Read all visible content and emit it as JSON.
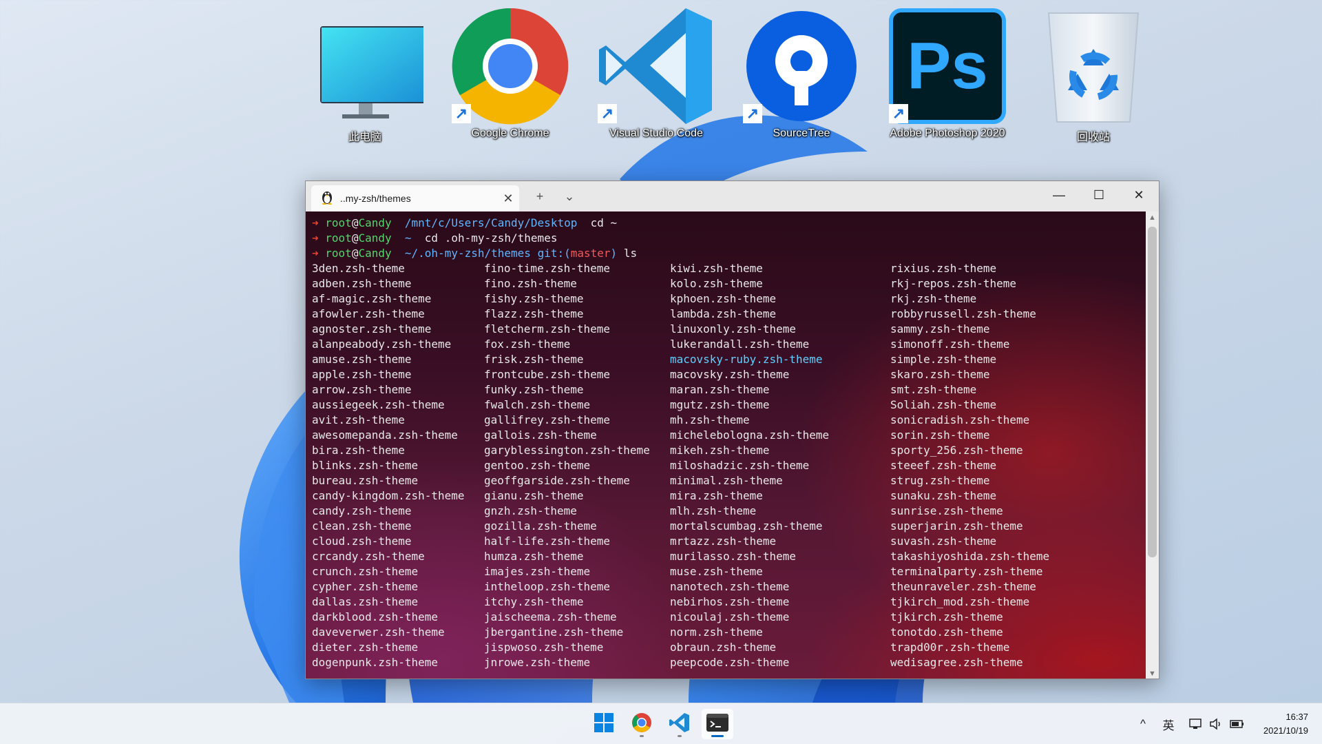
{
  "desktop_icons": [
    {
      "name": "this-pc",
      "label": "此电脑",
      "icon": "monitor-icon",
      "shortcut": false
    },
    {
      "name": "google-chrome",
      "label": "Google Chrome",
      "icon": "chrome-icon",
      "shortcut": true
    },
    {
      "name": "visual-studio-code",
      "label": "Visual Studio Code",
      "icon": "vscode-icon",
      "shortcut": true
    },
    {
      "name": "sourcetree",
      "label": "SourceTree",
      "icon": "sourcetree-icon",
      "shortcut": true
    },
    {
      "name": "adobe-photoshop",
      "label": "Adobe Photoshop 2020",
      "icon": "photoshop-icon",
      "shortcut": true,
      "icon_text": "Ps"
    },
    {
      "name": "recycle-bin",
      "label": "回收站",
      "icon": "recycle-bin-icon",
      "shortcut": false
    }
  ],
  "terminal": {
    "tab_title": "..my-zsh/themes",
    "tab_icon": "linux-penguin-icon",
    "new_tab_glyph": "+",
    "dropdown_glyph": "⌄",
    "minimize_glyph": "—",
    "maximize_glyph": "☐",
    "close_glyph": "✕",
    "prompts": [
      {
        "arrow": "➜",
        "user": "root",
        "at": "@",
        "host": "Candy",
        "path": "/mnt/c/Users/Candy/Desktop",
        "git_label": "",
        "branch": "",
        "cmd": "cd ~"
      },
      {
        "arrow": "➜",
        "user": "root",
        "at": "@",
        "host": "Candy",
        "path": "~",
        "git_label": "",
        "branch": "",
        "cmd": "cd .oh-my-zsh/themes"
      },
      {
        "arrow": "➜",
        "user": "root",
        "at": "@",
        "host": "Candy",
        "path": "~/.oh-my-zsh/themes",
        "git_label": "git:(",
        "branch": "master",
        "git_close": ")",
        "cmd": "ls"
      }
    ],
    "highlighted_file": "macovsky-ruby.zsh-theme",
    "ls_columns": [
      [
        "3den.zsh-theme",
        "adben.zsh-theme",
        "af-magic.zsh-theme",
        "afowler.zsh-theme",
        "agnoster.zsh-theme",
        "alanpeabody.zsh-theme",
        "amuse.zsh-theme",
        "apple.zsh-theme",
        "arrow.zsh-theme",
        "aussiegeek.zsh-theme",
        "avit.zsh-theme",
        "awesomepanda.zsh-theme",
        "bira.zsh-theme",
        "blinks.zsh-theme",
        "bureau.zsh-theme",
        "candy-kingdom.zsh-theme",
        "candy.zsh-theme",
        "clean.zsh-theme",
        "cloud.zsh-theme",
        "crcandy.zsh-theme",
        "crunch.zsh-theme",
        "cypher.zsh-theme",
        "dallas.zsh-theme",
        "darkblood.zsh-theme",
        "daveverwer.zsh-theme",
        "dieter.zsh-theme",
        "dogenpunk.zsh-theme"
      ],
      [
        "fino-time.zsh-theme",
        "fino.zsh-theme",
        "fishy.zsh-theme",
        "flazz.zsh-theme",
        "fletcherm.zsh-theme",
        "fox.zsh-theme",
        "frisk.zsh-theme",
        "frontcube.zsh-theme",
        "funky.zsh-theme",
        "fwalch.zsh-theme",
        "gallifrey.zsh-theme",
        "gallois.zsh-theme",
        "garyblessington.zsh-theme",
        "gentoo.zsh-theme",
        "geoffgarside.zsh-theme",
        "gianu.zsh-theme",
        "gnzh.zsh-theme",
        "gozilla.zsh-theme",
        "half-life.zsh-theme",
        "humza.zsh-theme",
        "imajes.zsh-theme",
        "intheloop.zsh-theme",
        "itchy.zsh-theme",
        "jaischeema.zsh-theme",
        "jbergantine.zsh-theme",
        "jispwoso.zsh-theme",
        "jnrowe.zsh-theme"
      ],
      [
        "kiwi.zsh-theme",
        "kolo.zsh-theme",
        "kphoen.zsh-theme",
        "lambda.zsh-theme",
        "linuxonly.zsh-theme",
        "lukerandall.zsh-theme",
        "macovsky-ruby.zsh-theme",
        "macovsky.zsh-theme",
        "maran.zsh-theme",
        "mgutz.zsh-theme",
        "mh.zsh-theme",
        "michelebologna.zsh-theme",
        "mikeh.zsh-theme",
        "miloshadzic.zsh-theme",
        "minimal.zsh-theme",
        "mira.zsh-theme",
        "mlh.zsh-theme",
        "mortalscumbag.zsh-theme",
        "mrtazz.zsh-theme",
        "murilasso.zsh-theme",
        "muse.zsh-theme",
        "nanotech.zsh-theme",
        "nebirhos.zsh-theme",
        "nicoulaj.zsh-theme",
        "norm.zsh-theme",
        "obraun.zsh-theme",
        "peepcode.zsh-theme"
      ],
      [
        "rixius.zsh-theme",
        "rkj-repos.zsh-theme",
        "rkj.zsh-theme",
        "robbyrussell.zsh-theme",
        "sammy.zsh-theme",
        "simonoff.zsh-theme",
        "simple.zsh-theme",
        "skaro.zsh-theme",
        "smt.zsh-theme",
        "Soliah.zsh-theme",
        "sonicradish.zsh-theme",
        "sorin.zsh-theme",
        "sporty_256.zsh-theme",
        "steeef.zsh-theme",
        "strug.zsh-theme",
        "sunaku.zsh-theme",
        "sunrise.zsh-theme",
        "superjarin.zsh-theme",
        "suvash.zsh-theme",
        "takashiyoshida.zsh-theme",
        "terminalparty.zsh-theme",
        "theunraveler.zsh-theme",
        "tjkirch_mod.zsh-theme",
        "tjkirch.zsh-theme",
        "tonotdo.zsh-theme",
        "trapd00r.zsh-theme",
        "wedisagree.zsh-theme"
      ]
    ]
  },
  "taskbar": {
    "apps": [
      {
        "name": "start",
        "icon": "windows-start-icon"
      },
      {
        "name": "chrome",
        "icon": "chrome-icon",
        "running": true
      },
      {
        "name": "vscode",
        "icon": "vscode-icon",
        "running": true
      },
      {
        "name": "terminal",
        "icon": "terminal-icon",
        "running": true,
        "active": true
      }
    ],
    "tray": {
      "chevron": "^",
      "ime": "英",
      "network_icon": "network-icon",
      "volume_icon": "volume-icon",
      "battery_icon": "battery-icon"
    },
    "time": "16:37",
    "date": "2021/10/19"
  },
  "colors": {
    "accent": "#0067c0",
    "prompt_arrow": "#f0442f",
    "prompt_user": "#4fd96a",
    "prompt_path": "#5fb6ff",
    "git_branch": "#f05a5a",
    "highlight_file": "#5fd0ff"
  }
}
